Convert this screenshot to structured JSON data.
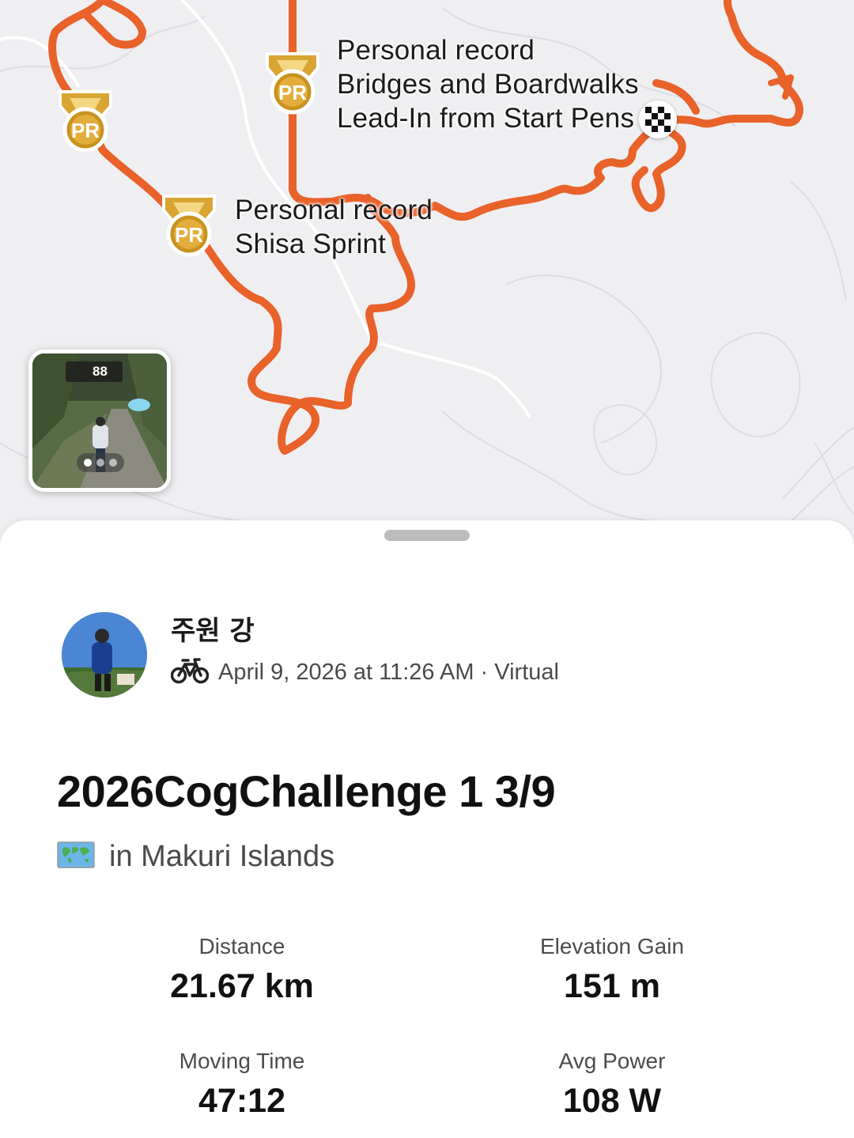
{
  "map": {
    "route_color": "#e8622a",
    "pr_badge_text": "PR",
    "labels": {
      "shisa": "Personal record\nShisa Sprint",
      "bridges": "Personal record\nBridges and Boardwalks\nLead-In from Start Pens"
    },
    "thumbnail": {
      "hud_value": "88"
    }
  },
  "activity": {
    "athlete_name": "주원 강",
    "sport_icon": "bike-icon",
    "date_meta": "April 9, 2026 at 11:26 AM · Virtual",
    "title": "2026CogChallenge 1 3/9",
    "location_icon": "world-map-icon",
    "location": "in Makuri Islands"
  },
  "stats": {
    "distance": {
      "label": "Distance",
      "value": "21.67 km"
    },
    "elevation": {
      "label": "Elevation Gain",
      "value": "151 m"
    },
    "moving_time": {
      "label": "Moving Time",
      "value": "47:12"
    },
    "avg_power": {
      "label": "Avg Power",
      "value": "108 W"
    }
  }
}
